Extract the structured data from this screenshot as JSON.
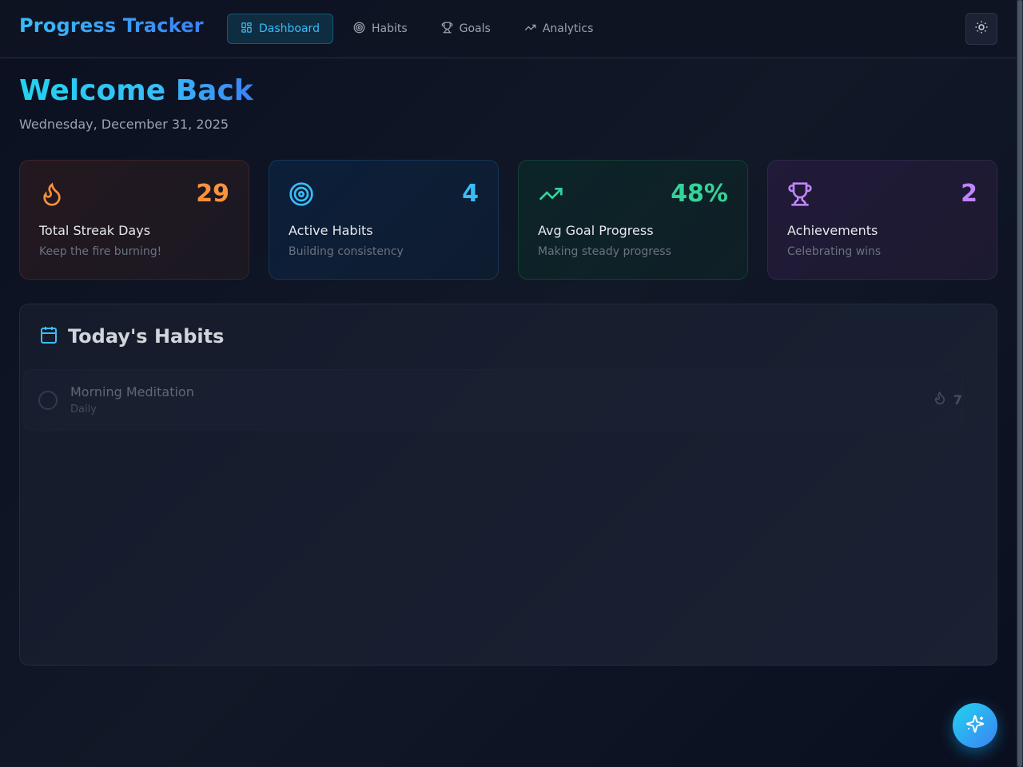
{
  "header": {
    "brand": "Progress Tracker",
    "nav": [
      {
        "label": "Dashboard",
        "icon": "dashboard-icon",
        "active": true
      },
      {
        "label": "Habits",
        "icon": "target-icon",
        "active": false
      },
      {
        "label": "Goals",
        "icon": "trophy-icon",
        "active": false
      },
      {
        "label": "Analytics",
        "icon": "trending-up-icon",
        "active": false
      }
    ],
    "theme_toggle_icon": "sun-icon"
  },
  "welcome": {
    "title": "Welcome Back",
    "date": "Wednesday, December 31, 2025"
  },
  "stats": [
    {
      "value": "29",
      "label": "Total Streak Days",
      "sub": "Keep the fire burning!",
      "icon": "flame-icon",
      "color": "#fb923c"
    },
    {
      "value": "4",
      "label": "Active Habits",
      "sub": "Building consistency",
      "icon": "target-icon",
      "color": "#38bdf8"
    },
    {
      "value": "48%",
      "label": "Avg Goal Progress",
      "sub": "Making steady progress",
      "icon": "trending-up-icon",
      "color": "#34d399"
    },
    {
      "value": "2",
      "label": "Achievements",
      "sub": "Celebrating wins",
      "icon": "trophy-icon",
      "color": "#c084fc"
    }
  ],
  "habits": {
    "title": "Today's Habits",
    "icon": "calendar-icon",
    "items": [
      {
        "name": "Morning Meditation",
        "frequency": "Daily",
        "streak": "7"
      }
    ]
  },
  "fab": {
    "icon": "sparkles-icon"
  },
  "colors": {
    "accent": "#38bdf8",
    "background": "#0b1020"
  }
}
